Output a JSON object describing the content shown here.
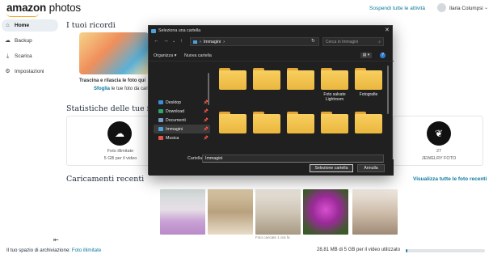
{
  "app": {
    "logo_text": "amazon",
    "logo_text2": " photos"
  },
  "topbar": {
    "pause_link": "Sospendi tutte le attività",
    "user_name": "Ilaria Columpsi"
  },
  "sidebar": {
    "items": [
      {
        "label": "Home",
        "icon": "home-icon",
        "glyph": "⌂",
        "active": true
      },
      {
        "label": "Backup",
        "icon": "backup-cloud-icon",
        "glyph": "☁"
      },
      {
        "label": "Scarica",
        "icon": "download-icon",
        "glyph": "⤓"
      },
      {
        "label": "Impostazioni",
        "icon": "gear-icon",
        "glyph": "⚙"
      }
    ],
    "collapse_glyph": "⇤"
  },
  "memories": {
    "title": "I tuoi ricordi",
    "drag_text": "Trascina e rilascia le foto qui",
    "browse_link": "Sfoglia",
    "browse_rest": " le tue foto da caricare"
  },
  "stats": {
    "title": "Statistiche delle tue foto",
    "cards": [
      {
        "line1": "Foto illimitate",
        "line2": "5 GB per il video",
        "icon": "cloud-icon",
        "glyph": "☁"
      },
      {
        "line1": "27",
        "line2": "JEWELRY FOTO",
        "icon": "leaf-icon",
        "glyph": "❦"
      }
    ]
  },
  "recent": {
    "title": "Caricamenti recenti",
    "view_all": "Visualizza tutte le foto recenti",
    "caption": "Foto caricate 1 ora fa"
  },
  "bottom": {
    "storage_label": "Il tuo spazio di archiviazione: ",
    "storage_link": "Foto illimitate",
    "video_usage": "28,81 MB di 5 GB per il video utilizzato",
    "video_usage_fraction": 0.006
  },
  "dialog": {
    "title": "Seleziona una cartella",
    "close_glyph": "✕",
    "breadcrumb": "Immagini",
    "search_placeholder": "Cerca in Immagini",
    "organize": "Organizza ▾",
    "new_folder": "Nuova cartella",
    "side_items": [
      {
        "label": "Desktop",
        "color": "#3a8fd8"
      },
      {
        "label": "Download",
        "color": "#2aa86b"
      },
      {
        "label": "Documenti",
        "color": "#7a9cc6"
      },
      {
        "label": "Immagini",
        "color": "#4aa3df",
        "selected": true
      },
      {
        "label": "Musica",
        "color": "#e0574a"
      }
    ],
    "folders": [
      {
        "label": ""
      },
      {
        "label": ""
      },
      {
        "label": ""
      },
      {
        "label": "Foto salvate Lightroom"
      },
      {
        "label": "Fotografie"
      },
      {
        "label": ""
      },
      {
        "label": ""
      },
      {
        "label": ""
      },
      {
        "label": ""
      },
      {
        "label": ""
      }
    ],
    "folder_field_label": "Cartella:",
    "folder_field_value": "Immagini",
    "select_button": "Selezione cartella",
    "cancel_button": "Annulla"
  }
}
